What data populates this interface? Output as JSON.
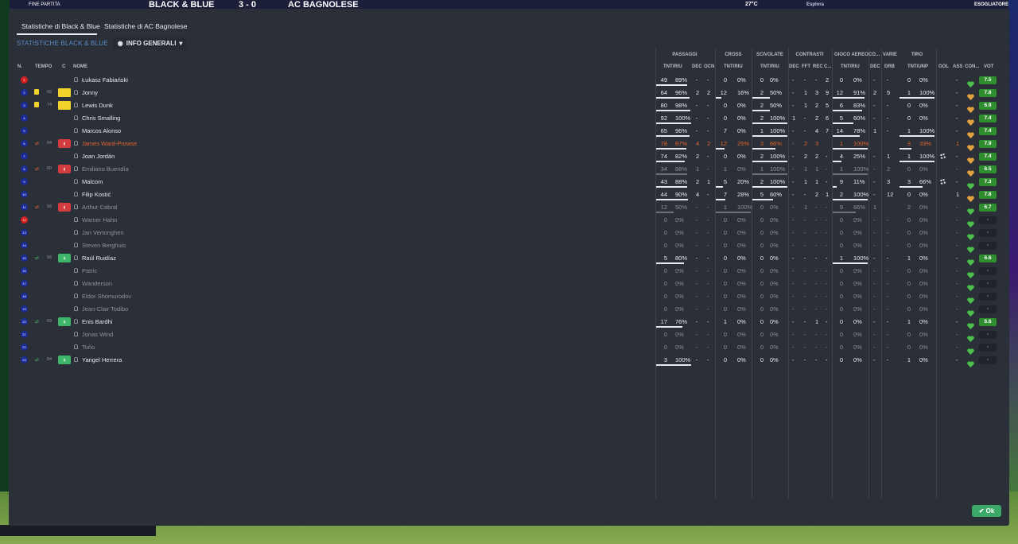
{
  "topbar": {
    "left_label": "FINE PARTITA",
    "team_home": "BLACK & BLUE",
    "score": "3 - 0",
    "team_away": "AC BAGNOLESE",
    "right_clock": "27°C",
    "right_btn": "Esplora",
    "right_user": "ESOGLIATORE"
  },
  "tabs": {
    "home": "Statistiche di Black & Blue",
    "away": "Statistiche di AC Bagnolese"
  },
  "subbar": {
    "team_label": "STATISTICHE BLACK & BLUE",
    "view": "INFO GENERALI"
  },
  "headers": {
    "n": "N.",
    "tempo": "TEMPO",
    "c": "C",
    "nome": "NOME",
    "passaggi": "PASSAGGI",
    "cross": "CROSS",
    "scivolate": "SCIVOLATE",
    "contrasti": "CONTRASTI",
    "gioco_aereo": "GIOCO AEREO",
    "co": "CO...",
    "varie": "VARIE",
    "tiro": "TIRO",
    "tnt_riu": "TNT/RIU",
    "dec": "DEC",
    "ocn": "OCN",
    "fft": "FFT",
    "rec": "REC",
    "c_dots": "C...",
    "drb": "DRB",
    "tnt_unp": "TNT/UNP",
    "gol": "GOL",
    "ass": "ASS",
    "con": "CON...",
    "vot": "VOT"
  },
  "players": [
    {
      "n": "1",
      "red": true,
      "tempo": "",
      "card": "",
      "sub": "",
      "name": "Łukasz Fabiański",
      "style": "",
      "p_tr": "49",
      "p_pc": "89%",
      "p_bar": 0.89,
      "dec": "-",
      "ocn": "-",
      "cr_tr": "0",
      "cr_pc": "0%",
      "cr_bar": 0,
      "sc_tr": "0",
      "sc_pc": "0%",
      "sc_bar": 0,
      "c_dec": "-",
      "c_fft": "-",
      "c_rec": "-",
      "c_c": "2",
      "ga_tr": "0",
      "ga_pc": "0%",
      "ga_bar": 0,
      "co": "-",
      "drb": "-",
      "t_tr": "0",
      "t_pc": "0%",
      "t_bar": 0,
      "gol": "",
      "ass": "-",
      "heart": "green",
      "vot": "7.5"
    },
    {
      "n": "2",
      "red": false,
      "tempo": "66",
      "card": "y",
      "sub": "",
      "name": "Jonny",
      "style": "",
      "p_tr": "64",
      "p_pc": "96%",
      "p_bar": 0.96,
      "dec": "2",
      "ocn": "2",
      "cr_tr": "12",
      "cr_pc": "16%",
      "cr_bar": 0.16,
      "sc_tr": "2",
      "sc_pc": "50%",
      "sc_bar": 0.5,
      "c_dec": "-",
      "c_fft": "1",
      "c_rec": "3",
      "c_c": "9",
      "ga_tr": "12",
      "ga_pc": "91%",
      "ga_bar": 0.91,
      "co": "2",
      "drb": "5",
      "t_tr": "1",
      "t_pc": "100%",
      "t_bar": 1,
      "gol": "",
      "ass": "-",
      "heart": "orange",
      "vot": "7.8"
    },
    {
      "n": "3",
      "red": false,
      "tempo": "74",
      "card": "y",
      "sub": "",
      "name": "Lewis Dunk",
      "style": "",
      "p_tr": "80",
      "p_pc": "98%",
      "p_bar": 0.98,
      "dec": "-",
      "ocn": "-",
      "cr_tr": "0",
      "cr_pc": "0%",
      "cr_bar": 0,
      "sc_tr": "2",
      "sc_pc": "50%",
      "sc_bar": 0.5,
      "c_dec": "-",
      "c_fft": "1",
      "c_rec": "2",
      "c_c": "5",
      "ga_tr": "6",
      "ga_pc": "83%",
      "ga_bar": 0.83,
      "co": "-",
      "drb": "-",
      "t_tr": "0",
      "t_pc": "0%",
      "t_bar": 0,
      "gol": "",
      "ass": "-",
      "heart": "orange",
      "vot": "6.9"
    },
    {
      "n": "4",
      "red": false,
      "tempo": "",
      "card": "",
      "sub": "",
      "name": "Chris Smalling",
      "style": "",
      "p_tr": "92",
      "p_pc": "100%",
      "p_bar": 1,
      "dec": "-",
      "ocn": "-",
      "cr_tr": "0",
      "cr_pc": "0%",
      "cr_bar": 0,
      "sc_tr": "2",
      "sc_pc": "100%",
      "sc_bar": 1,
      "c_dec": "1",
      "c_fft": "-",
      "c_rec": "2",
      "c_c": "6",
      "ga_tr": "5",
      "ga_pc": "60%",
      "ga_bar": 0.6,
      "co": "-",
      "drb": "-",
      "t_tr": "0",
      "t_pc": "0%",
      "t_bar": 0,
      "gol": "",
      "ass": "-",
      "heart": "orange",
      "vot": "7.4"
    },
    {
      "n": "5",
      "red": false,
      "tempo": "",
      "card": "",
      "sub": "",
      "name": "Marcos Alonso",
      "style": "",
      "p_tr": "65",
      "p_pc": "96%",
      "p_bar": 0.96,
      "dec": "-",
      "ocn": "-",
      "cr_tr": "7",
      "cr_pc": "0%",
      "cr_bar": 0,
      "sc_tr": "1",
      "sc_pc": "100%",
      "sc_bar": 1,
      "c_dec": "-",
      "c_fft": "-",
      "c_rec": "4",
      "c_c": "7",
      "ga_tr": "14",
      "ga_pc": "78%",
      "ga_bar": 0.78,
      "co": "1",
      "drb": "-",
      "t_tr": "1",
      "t_pc": "100%",
      "t_bar": 1,
      "gol": "",
      "ass": "-",
      "heart": "orange",
      "vot": "7.4"
    },
    {
      "n": "6",
      "red": false,
      "tempo": "64",
      "card": "",
      "sub": "off",
      "name": "James Ward-Prowse",
      "style": "orange",
      "p_tr": "78",
      "p_pc": "87%",
      "p_bar": 0.87,
      "dec": "4",
      "ocn": "2",
      "cr_tr": "12",
      "cr_pc": "25%",
      "cr_bar": 0.25,
      "sc_tr": "3",
      "sc_pc": "66%",
      "sc_bar": 0.66,
      "c_dec": "-",
      "c_fft": "2",
      "c_rec": "3",
      "c_c": "",
      "ga_tr": "1",
      "ga_pc": "100%",
      "ga_bar": 1,
      "co": "",
      "drb": "",
      "t_tr": "3",
      "t_pc": "33%",
      "t_bar": 0.33,
      "gol": "",
      "ass": "1",
      "heart": "orange",
      "vot": "7.9"
    },
    {
      "n": "7",
      "red": false,
      "tempo": "",
      "card": "",
      "sub": "",
      "name": "Joan Jordán",
      "style": "",
      "p_tr": "74",
      "p_pc": "82%",
      "p_bar": 0.82,
      "dec": "2",
      "ocn": "-",
      "cr_tr": "0",
      "cr_pc": "0%",
      "cr_bar": 0,
      "sc_tr": "2",
      "sc_pc": "100%",
      "sc_bar": 1,
      "c_dec": "-",
      "c_fft": "2",
      "c_rec": "2",
      "c_c": "-",
      "ga_tr": "4",
      "ga_pc": "25%",
      "ga_bar": 0.25,
      "co": "-",
      "drb": "1",
      "t_tr": "1",
      "t_pc": "100%",
      "t_bar": 1,
      "gol": "cog",
      "ass": "-",
      "heart": "orange",
      "vot": "7.4"
    },
    {
      "n": "8",
      "red": false,
      "tempo": "60",
      "card": "",
      "sub": "off",
      "name": "Emiliano Buendía",
      "style": "muted",
      "p_tr": "34",
      "p_pc": "88%",
      "p_bar": 0.88,
      "dec": "1",
      "ocn": "-",
      "cr_tr": "1",
      "cr_pc": "0%",
      "cr_bar": 0,
      "sc_tr": "1",
      "sc_pc": "100%",
      "sc_bar": 1,
      "c_dec": "-",
      "c_fft": "1",
      "c_rec": "1",
      "c_c": "-",
      "ga_tr": "1",
      "ga_pc": "100%",
      "ga_bar": 1,
      "co": "-",
      "drb": "2",
      "t_tr": "0",
      "t_pc": "0%",
      "t_bar": 0,
      "gol": "",
      "ass": "-",
      "heart": "orange",
      "vot": "6.5"
    },
    {
      "n": "9",
      "red": false,
      "tempo": "",
      "card": "",
      "sub": "",
      "name": "Malcom",
      "style": "",
      "p_tr": "43",
      "p_pc": "88%",
      "p_bar": 0.88,
      "dec": "2",
      "ocn": "1",
      "cr_tr": "5",
      "cr_pc": "20%",
      "cr_bar": 0.2,
      "sc_tr": "2",
      "sc_pc": "100%",
      "sc_bar": 1,
      "c_dec": "-",
      "c_fft": "1",
      "c_rec": "1",
      "c_c": "-",
      "ga_tr": "9",
      "ga_pc": "11%",
      "ga_bar": 0.11,
      "co": "-",
      "drb": "3",
      "t_tr": "3",
      "t_pc": "66%",
      "t_bar": 0.66,
      "gol": "cog",
      "ass": "-",
      "heart": "green",
      "vot": "7.3"
    },
    {
      "n": "10",
      "red": false,
      "tempo": "",
      "card": "",
      "sub": "",
      "name": "Filip Kostić",
      "style": "",
      "p_tr": "44",
      "p_pc": "90%",
      "p_bar": 0.9,
      "dec": "4",
      "ocn": "-",
      "cr_tr": "7",
      "cr_pc": "28%",
      "cr_bar": 0.28,
      "sc_tr": "5",
      "sc_pc": "60%",
      "sc_bar": 0.6,
      "c_dec": "-",
      "c_fft": "-",
      "c_rec": "2",
      "c_c": "1",
      "ga_tr": "2",
      "ga_pc": "100%",
      "ga_bar": 1,
      "co": "-",
      "drb": "12",
      "t_tr": "0",
      "t_pc": "0%",
      "t_bar": 0,
      "gol": "",
      "ass": "1",
      "heart": "orange",
      "vot": "7.8"
    },
    {
      "n": "11",
      "red": false,
      "tempo": "56",
      "card": "",
      "sub": "off",
      "name": "Arthur Cabral",
      "style": "muted",
      "p_tr": "12",
      "p_pc": "50%",
      "p_bar": 0.5,
      "dec": "-",
      "ocn": "-",
      "cr_tr": "1",
      "cr_pc": "100%",
      "cr_bar": 1,
      "sc_tr": "0",
      "sc_pc": "0%",
      "sc_bar": 0,
      "c_dec": "-",
      "c_fft": "1",
      "c_rec": "-",
      "c_c": "-",
      "ga_tr": "9",
      "ga_pc": "66%",
      "ga_bar": 0.66,
      "co": "1",
      "drb": "",
      "t_tr": "2",
      "t_pc": "0%",
      "t_bar": 0,
      "gol": "",
      "ass": "-",
      "heart": "green",
      "vot": "6.7"
    },
    {
      "n": "12",
      "red": true,
      "tempo": "",
      "card": "",
      "sub": "",
      "name": "Warner Hahn",
      "style": "muted",
      "p_tr": "0",
      "p_pc": "0%",
      "p_bar": 0,
      "dec": "-",
      "ocn": "-",
      "cr_tr": "0",
      "cr_pc": "0%",
      "cr_bar": 0,
      "sc_tr": "0",
      "sc_pc": "0%",
      "sc_bar": 0,
      "c_dec": "-",
      "c_fft": "-",
      "c_rec": "-",
      "c_c": "-",
      "ga_tr": "0",
      "ga_pc": "0%",
      "ga_bar": 0,
      "co": "-",
      "drb": "-",
      "t_tr": "0",
      "t_pc": "0%",
      "t_bar": 0,
      "gol": "",
      "ass": "-",
      "heart": "green",
      "vot": "-"
    },
    {
      "n": "13",
      "red": false,
      "tempo": "",
      "card": "",
      "sub": "",
      "name": "Jan Vertonghen",
      "style": "muted",
      "p_tr": "0",
      "p_pc": "0%",
      "p_bar": 0,
      "dec": "-",
      "ocn": "-",
      "cr_tr": "0",
      "cr_pc": "0%",
      "cr_bar": 0,
      "sc_tr": "0",
      "sc_pc": "0%",
      "sc_bar": 0,
      "c_dec": "-",
      "c_fft": "-",
      "c_rec": "-",
      "c_c": "-",
      "ga_tr": "0",
      "ga_pc": "0%",
      "ga_bar": 0,
      "co": "-",
      "drb": "-",
      "t_tr": "0",
      "t_pc": "0%",
      "t_bar": 0,
      "gol": "",
      "ass": "-",
      "heart": "green",
      "vot": "-"
    },
    {
      "n": "14",
      "red": false,
      "tempo": "",
      "card": "",
      "sub": "",
      "name": "Steven Berghuis",
      "style": "muted",
      "p_tr": "0",
      "p_pc": "0%",
      "p_bar": 0,
      "dec": "-",
      "ocn": "-",
      "cr_tr": "0",
      "cr_pc": "0%",
      "cr_bar": 0,
      "sc_tr": "0",
      "sc_pc": "0%",
      "sc_bar": 0,
      "c_dec": "-",
      "c_fft": "-",
      "c_rec": "-",
      "c_c": "-",
      "ga_tr": "0",
      "ga_pc": "0%",
      "ga_bar": 0,
      "co": "-",
      "drb": "-",
      "t_tr": "0",
      "t_pc": "0%",
      "t_bar": 0,
      "gol": "",
      "ass": "-",
      "heart": "green",
      "vot": "-"
    },
    {
      "n": "15",
      "red": false,
      "tempo": "56",
      "card": "",
      "sub": "on",
      "name": "Raúl Ruidíaz",
      "style": "",
      "p_tr": "5",
      "p_pc": "80%",
      "p_bar": 0.8,
      "dec": "-",
      "ocn": "-",
      "cr_tr": "0",
      "cr_pc": "0%",
      "cr_bar": 0,
      "sc_tr": "0",
      "sc_pc": "0%",
      "sc_bar": 0,
      "c_dec": "-",
      "c_fft": "-",
      "c_rec": "-",
      "c_c": "-",
      "ga_tr": "1",
      "ga_pc": "100%",
      "ga_bar": 1,
      "co": "-",
      "drb": "-",
      "t_tr": "1",
      "t_pc": "0%",
      "t_bar": 0,
      "gol": "",
      "ass": "-",
      "heart": "green",
      "vot": "6.6"
    },
    {
      "n": "16",
      "red": false,
      "tempo": "",
      "card": "",
      "sub": "",
      "name": "Patric",
      "style": "muted",
      "p_tr": "0",
      "p_pc": "0%",
      "p_bar": 0,
      "dec": "-",
      "ocn": "-",
      "cr_tr": "0",
      "cr_pc": "0%",
      "cr_bar": 0,
      "sc_tr": "0",
      "sc_pc": "0%",
      "sc_bar": 0,
      "c_dec": "-",
      "c_fft": "-",
      "c_rec": "-",
      "c_c": "-",
      "ga_tr": "0",
      "ga_pc": "0%",
      "ga_bar": 0,
      "co": "-",
      "drb": "-",
      "t_tr": "0",
      "t_pc": "0%",
      "t_bar": 0,
      "gol": "",
      "ass": "-",
      "heart": "green",
      "vot": "-"
    },
    {
      "n": "17",
      "red": false,
      "tempo": "",
      "card": "",
      "sub": "",
      "name": "Wanderson",
      "style": "muted",
      "p_tr": "0",
      "p_pc": "0%",
      "p_bar": 0,
      "dec": "-",
      "ocn": "-",
      "cr_tr": "0",
      "cr_pc": "0%",
      "cr_bar": 0,
      "sc_tr": "0",
      "sc_pc": "0%",
      "sc_bar": 0,
      "c_dec": "-",
      "c_fft": "-",
      "c_rec": "-",
      "c_c": "-",
      "ga_tr": "0",
      "ga_pc": "0%",
      "ga_bar": 0,
      "co": "-",
      "drb": "-",
      "t_tr": "0",
      "t_pc": "0%",
      "t_bar": 0,
      "gol": "",
      "ass": "-",
      "heart": "green",
      "vot": "-"
    },
    {
      "n": "18",
      "red": false,
      "tempo": "",
      "card": "",
      "sub": "",
      "name": "Eldor Shomurodov",
      "style": "muted",
      "p_tr": "0",
      "p_pc": "0%",
      "p_bar": 0,
      "dec": "-",
      "ocn": "-",
      "cr_tr": "0",
      "cr_pc": "0%",
      "cr_bar": 0,
      "sc_tr": "0",
      "sc_pc": "0%",
      "sc_bar": 0,
      "c_dec": "-",
      "c_fft": "-",
      "c_rec": "-",
      "c_c": "-",
      "ga_tr": "0",
      "ga_pc": "0%",
      "ga_bar": 0,
      "co": "-",
      "drb": "-",
      "t_tr": "0",
      "t_pc": "0%",
      "t_bar": 0,
      "gol": "",
      "ass": "-",
      "heart": "green",
      "vot": "-"
    },
    {
      "n": "19",
      "red": false,
      "tempo": "",
      "card": "",
      "sub": "",
      "name": "Jean-Clair Todibo",
      "style": "muted",
      "p_tr": "0",
      "p_pc": "0%",
      "p_bar": 0,
      "dec": "-",
      "ocn": "-",
      "cr_tr": "0",
      "cr_pc": "0%",
      "cr_bar": 0,
      "sc_tr": "0",
      "sc_pc": "0%",
      "sc_bar": 0,
      "c_dec": "-",
      "c_fft": "-",
      "c_rec": "-",
      "c_c": "-",
      "ga_tr": "0",
      "ga_pc": "0%",
      "ga_bar": 0,
      "co": "-",
      "drb": "-",
      "t_tr": "0",
      "t_pc": "0%",
      "t_bar": 0,
      "gol": "",
      "ass": "-",
      "heart": "green",
      "vot": "-"
    },
    {
      "n": "20",
      "red": false,
      "tempo": "69",
      "card": "",
      "sub": "on",
      "name": "Enis Bardhi",
      "style": "",
      "p_tr": "17",
      "p_pc": "76%",
      "p_bar": 0.76,
      "dec": "-",
      "ocn": "-",
      "cr_tr": "1",
      "cr_pc": "0%",
      "cr_bar": 0,
      "sc_tr": "0",
      "sc_pc": "0%",
      "sc_bar": 0,
      "c_dec": "-",
      "c_fft": "-",
      "c_rec": "1",
      "c_c": "-",
      "ga_tr": "0",
      "ga_pc": "0%",
      "ga_bar": 0,
      "co": "-",
      "drb": "-",
      "t_tr": "1",
      "t_pc": "0%",
      "t_bar": 0,
      "gol": "",
      "ass": "-",
      "heart": "green",
      "vot": "6.6"
    },
    {
      "n": "21",
      "red": false,
      "tempo": "",
      "card": "",
      "sub": "",
      "name": "Jonas Wind",
      "style": "muted",
      "p_tr": "0",
      "p_pc": "0%",
      "p_bar": 0,
      "dec": "-",
      "ocn": "-",
      "cr_tr": "0",
      "cr_pc": "0%",
      "cr_bar": 0,
      "sc_tr": "0",
      "sc_pc": "0%",
      "sc_bar": 0,
      "c_dec": "-",
      "c_fft": "-",
      "c_rec": "-",
      "c_c": "-",
      "ga_tr": "0",
      "ga_pc": "0%",
      "ga_bar": 0,
      "co": "-",
      "drb": "-",
      "t_tr": "0",
      "t_pc": "0%",
      "t_bar": 0,
      "gol": "",
      "ass": "-",
      "heart": "green",
      "vot": "-"
    },
    {
      "n": "22",
      "red": false,
      "tempo": "",
      "card": "",
      "sub": "",
      "name": "Toño",
      "style": "muted",
      "p_tr": "0",
      "p_pc": "0%",
      "p_bar": 0,
      "dec": "-",
      "ocn": "-",
      "cr_tr": "0",
      "cr_pc": "0%",
      "cr_bar": 0,
      "sc_tr": "0",
      "sc_pc": "0%",
      "sc_bar": 0,
      "c_dec": "-",
      "c_fft": "-",
      "c_rec": "-",
      "c_c": "-",
      "ga_tr": "0",
      "ga_pc": "0%",
      "ga_bar": 0,
      "co": "-",
      "drb": "-",
      "t_tr": "0",
      "t_pc": "0%",
      "t_bar": 0,
      "gol": "",
      "ass": "-",
      "heart": "green",
      "vot": "-"
    },
    {
      "n": "23",
      "red": false,
      "tempo": "84",
      "card": "",
      "sub": "on",
      "name": "Yangel Herrera",
      "style": "",
      "p_tr": "3",
      "p_pc": "100%",
      "p_bar": 1,
      "dec": "-",
      "ocn": "-",
      "cr_tr": "0",
      "cr_pc": "0%",
      "cr_bar": 0,
      "sc_tr": "0",
      "sc_pc": "0%",
      "sc_bar": 0,
      "c_dec": "-",
      "c_fft": "-",
      "c_rec": "-",
      "c_c": "-",
      "ga_tr": "0",
      "ga_pc": "0%",
      "ga_bar": 0,
      "co": "-",
      "drb": "-",
      "t_tr": "1",
      "t_pc": "0%",
      "t_bar": 0,
      "gol": "",
      "ass": "-",
      "heart": "green",
      "vot": "-"
    }
  ],
  "ok_label": "Ok",
  "colors": {
    "accent_green": "#3aa867",
    "rating_green": "#2f8e2f",
    "shirt_blue": "#1c2a9a",
    "gk_red": "#d42020",
    "sub_off": "#d23c3c",
    "sub_on": "#3fb56a",
    "orange": "#e2642d",
    "card_yellow": "#f2d22a"
  }
}
